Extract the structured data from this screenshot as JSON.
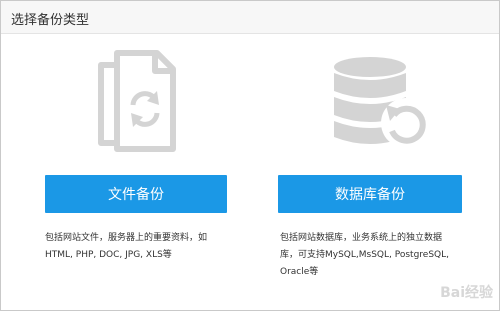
{
  "dialog": {
    "title": "选择备份类型"
  },
  "file_backup": {
    "icon": "file-sync-icon",
    "button_label": "文件备份",
    "description_line1": "包括网站文件，服务器上的重要资料，如",
    "description_line2": "HTML, PHP, DOC, JPG, XLS等"
  },
  "db_backup": {
    "icon": "database-restore-icon",
    "button_label": "数据库备份",
    "description_line1": "包括网站数据库，业务系统上的独立数据",
    "description_line2": "库，可支持MySQL,MsSQL, PostgreSQL,",
    "description_line3": "Oracle等"
  },
  "watermark": "Bai经验",
  "colors": {
    "accent": "#1b98e6",
    "icon_gray": "#d4d4d4"
  }
}
